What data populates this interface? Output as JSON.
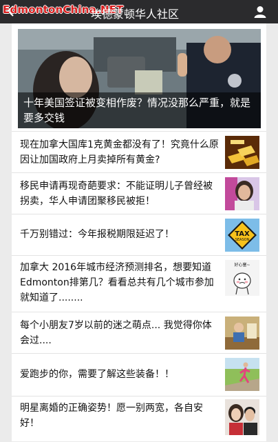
{
  "header": {
    "watermark": "EdmontonChina.NET",
    "title": "埃德蒙顿华人社区"
  },
  "hero": {
    "headline": "十年美国签证被变相作废？情况没那么严重，就是要多交钱"
  },
  "articles": [
    {
      "title": "现在加拿大国库1克黄金都没有了！究竟什么原因让加国政府上月卖掉所有黄金?",
      "thumb": "gold-bars"
    },
    {
      "title": "移民申请再现奇葩要求：不能证明儿子曾经被拐卖，华人申请团聚移民被拒！",
      "thumb": "woman-portrait"
    },
    {
      "title": "千万别错过：今年报税期限延迟了！",
      "thumb": "tax-sign",
      "thumb_text_1": "TAX",
      "thumb_text_2": "SEASON"
    },
    {
      "title": "加拿大 2016年城市经济预测排名，想要知道Edmonton排第几？看看总共有几个城市参加就知道了........",
      "thumb": "cartoon",
      "thumb_text": "好心塞~"
    },
    {
      "title": "每个小朋友7岁以前的迷之萌点... 我觉得你体会过....",
      "thumb": "child-photo"
    },
    {
      "title": "爱跑步的你，需要了解这些装备！！",
      "thumb": "runner-photo"
    },
    {
      "title": "明星离婚的正确姿势！愿一别两宽，各自安好！",
      "thumb": "couple-photo"
    }
  ]
}
